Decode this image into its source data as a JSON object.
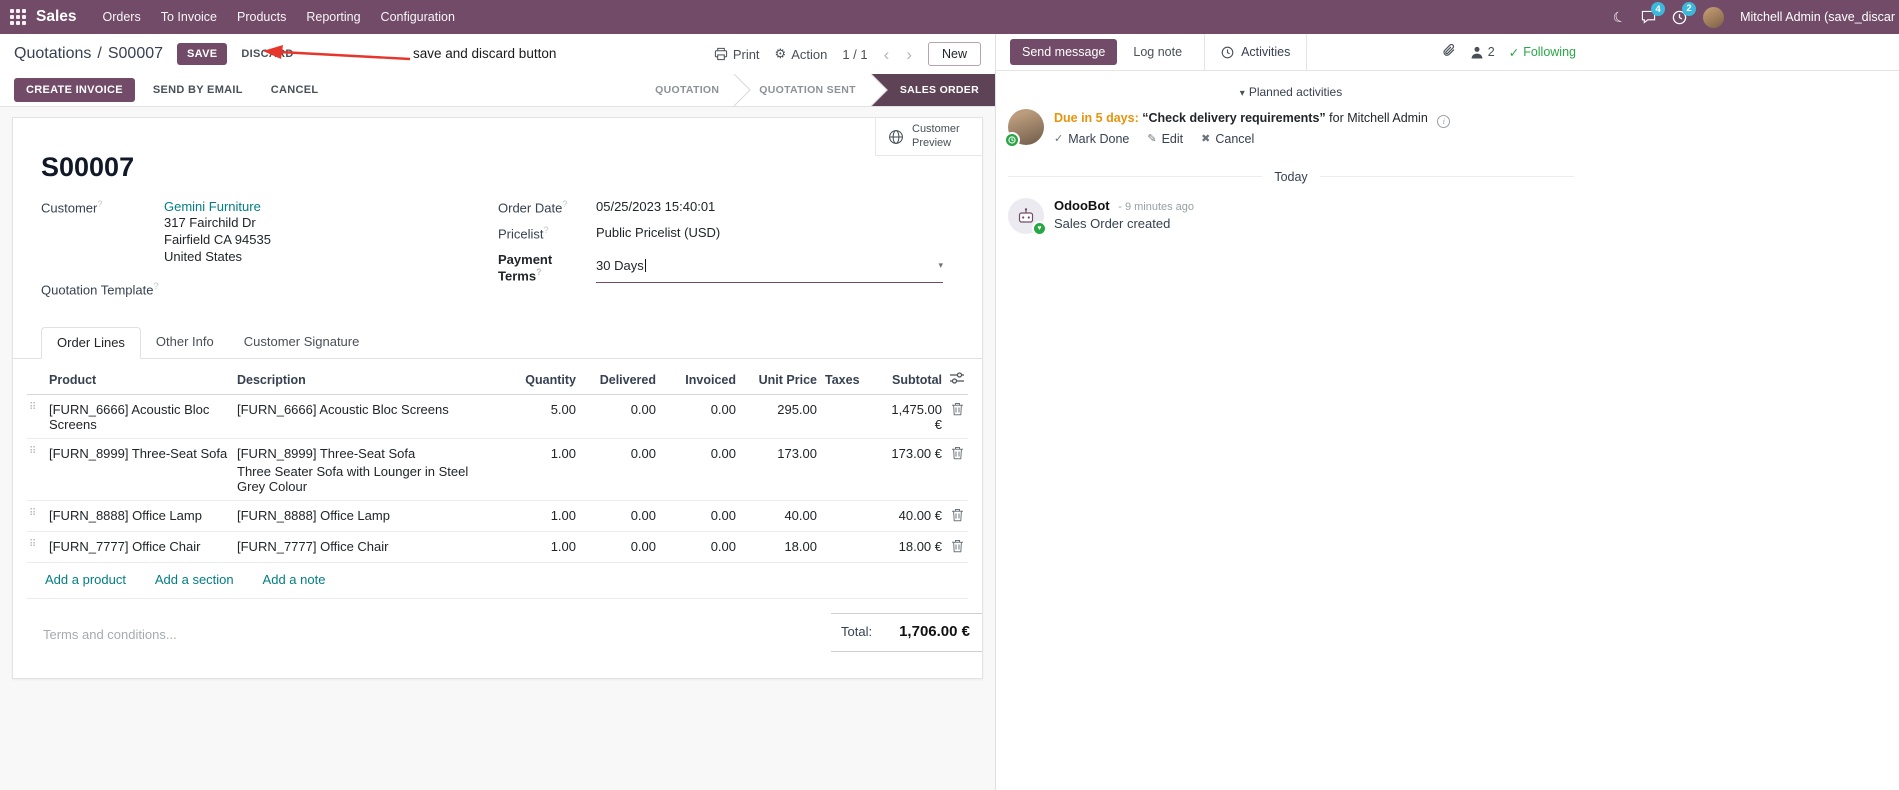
{
  "colors": {
    "accent": "#714B67",
    "stage_active": "#5e4256",
    "link_teal": "#017e84",
    "modified_blue": "#2779b5",
    "annotation_red": "#e8352c",
    "success_green": "#28a745",
    "due_orange": "#e8930c",
    "badge_cyan": "#3cb8dc"
  },
  "icons": {
    "moon": "☾",
    "gear": "⚙",
    "caret_down": "▾",
    "check": "✓",
    "pencil": "✎",
    "cross": "✖",
    "drag": "⠿",
    "chevron_left": "‹",
    "chevron_right": "›",
    "heart": "♥",
    "info": "i",
    "help": "?"
  },
  "nav": {
    "brand": "Sales",
    "items": [
      "Orders",
      "To Invoice",
      "Products",
      "Reporting",
      "Configuration"
    ],
    "messages_badge": "4",
    "activities_badge": "2",
    "user": "Mitchell Admin (save_discar"
  },
  "control": {
    "breadcrumb_parent": "Quotations",
    "breadcrumb_sep": "/",
    "breadcrumb_current": "S00007",
    "save": "SAVE",
    "discard": "DISCARD",
    "annotation": "save and discard button",
    "print": "Print",
    "action": "Action",
    "pager": "1 / 1",
    "new": "New"
  },
  "statusbar": {
    "create_invoice": "CREATE INVOICE",
    "send_by_email": "SEND BY EMAIL",
    "cancel": "CANCEL",
    "stages": [
      {
        "label": "QUOTATION"
      },
      {
        "label": "QUOTATION SENT"
      },
      {
        "label": "SALES ORDER"
      }
    ]
  },
  "sheet": {
    "customer_preview": "Customer Preview",
    "title": "S00007",
    "fields": {
      "customer_label": "Customer",
      "customer_name": "Gemini Furniture",
      "address1": "317 Fairchild Dr",
      "address2": "Fairfield CA 94535",
      "address3": "United States",
      "template_label": "Quotation Template",
      "order_date_label": "Order Date",
      "order_date": "05/25/2023 15:40:01",
      "pricelist_label": "Pricelist",
      "pricelist": "Public Pricelist (USD)",
      "payment_terms_label": "Payment Terms",
      "payment_terms": "30 Days"
    },
    "tabs": {
      "order_lines": "Order Lines",
      "other_info": "Other Info",
      "customer_signature": "Customer Signature"
    },
    "table": {
      "headers": {
        "product": "Product",
        "description": "Description",
        "quantity": "Quantity",
        "delivered": "Delivered",
        "invoiced": "Invoiced",
        "unit_price": "Unit Price",
        "taxes": "Taxes",
        "subtotal": "Subtotal"
      },
      "rows": [
        {
          "product": "[FURN_6666] Acoustic Bloc Screens",
          "description": "[FURN_6666] Acoustic Bloc Screens",
          "description2": "",
          "quantity": "5.00",
          "delivered": "0.00",
          "invoiced": "0.00",
          "unit_price": "295.00",
          "taxes": "",
          "subtotal": "1,475.00 €"
        },
        {
          "product": "[FURN_8999] Three-Seat Sofa",
          "description": "[FURN_8999] Three-Seat Sofa",
          "description2": "Three Seater Sofa with Lounger in Steel Grey Colour",
          "quantity": "1.00",
          "delivered": "0.00",
          "invoiced": "0.00",
          "unit_price": "173.00",
          "taxes": "",
          "subtotal": "173.00 €"
        },
        {
          "product": "[FURN_8888] Office Lamp",
          "description": "[FURN_8888] Office Lamp",
          "description2": "",
          "quantity": "1.00",
          "delivered": "0.00",
          "invoiced": "0.00",
          "unit_price": "40.00",
          "taxes": "",
          "subtotal": "40.00 €"
        },
        {
          "product": "[FURN_7777] Office Chair",
          "description": "[FURN_7777] Office Chair",
          "description2": "",
          "quantity": "1.00",
          "delivered": "0.00",
          "invoiced": "0.00",
          "unit_price": "18.00",
          "taxes": "",
          "subtotal": "18.00 €"
        }
      ],
      "add_product": "Add a product",
      "add_section": "Add a section",
      "add_note": "Add a note"
    },
    "terms_placeholder": "Terms and conditions...",
    "total_label": "Total:",
    "total_value": "1,706.00 €"
  },
  "chatter": {
    "send_message": "Send message",
    "log_note": "Log note",
    "activities": "Activities",
    "followers_count": "2",
    "following": "Following",
    "planned_activities": "Planned activities",
    "activity": {
      "due": "Due in 5 days:",
      "summary": "“Check delivery requirements”",
      "for_text": "for Mitchell Admin",
      "mark_done": "Mark Done",
      "edit": "Edit",
      "cancel": "Cancel"
    },
    "today": "Today",
    "message": {
      "author": "OdooBot",
      "time": "- 9 minutes ago",
      "body": "Sales Order created"
    }
  }
}
